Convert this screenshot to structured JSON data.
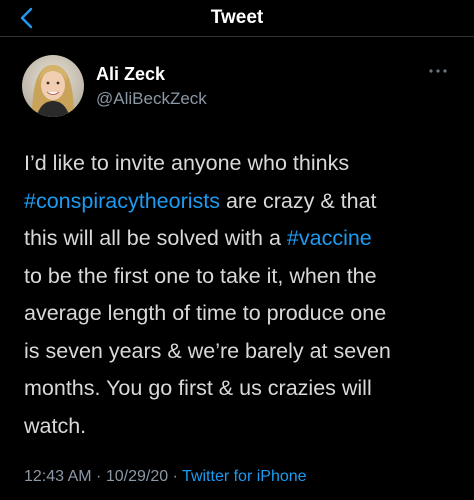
{
  "header": {
    "title": "Tweet",
    "back_icon": "chevron-left-icon"
  },
  "author": {
    "name": "Ali Zeck",
    "handle": "@AliBeckZeck",
    "avatar_icon": "avatar-photo"
  },
  "more_icon": "ellipsis-icon",
  "tweet": {
    "lines": [
      {
        "a": "I’d like to invite anyone who thinks"
      },
      {
        "tag": "#conspiracytheorists",
        "b": " are crazy & that"
      },
      {
        "a": "this will all be solved with a ",
        "tag": "#vaccine"
      },
      {
        "a": "to be the first one to take it, when the"
      },
      {
        "a": "average length of time to produce one"
      },
      {
        "a": "is seven years & we’re barely at seven"
      },
      {
        "a": "months. You go first & us crazies will"
      },
      {
        "a": "watch."
      }
    ]
  },
  "meta": {
    "time": "12:43 AM",
    "sep1": " · ",
    "date": "10/29/20",
    "sep2": " · ",
    "source": "Twitter for iPhone"
  },
  "colors": {
    "background": "#000000",
    "link": "#1d9bf0",
    "secondary": "#8b98a5",
    "text": "#d9d9d9"
  }
}
